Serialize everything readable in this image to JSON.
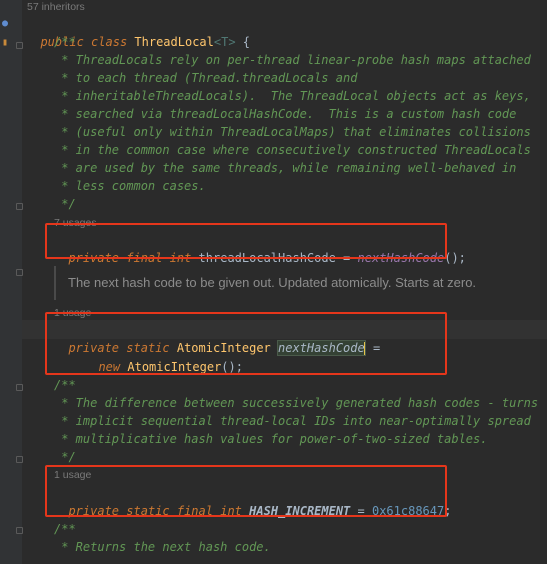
{
  "editor": {
    "inheritors_hint": "57 inheritors",
    "class_decl": {
      "kw_public": "public",
      "kw_class": "class",
      "name": "ThreadLocal",
      "generic": "<T>",
      "brace": " {"
    },
    "doc1": [
      "/**",
      " * ThreadLocals rely on per-thread linear-probe hash maps attached",
      " * to each thread (Thread.threadLocals and",
      " * inheritableThreadLocals).  The ThreadLocal objects act as keys,",
      " * searched via threadLocalHashCode.  This is a custom hash code",
      " * (useful only within ThreadLocalMaps) that eliminates collisions",
      " * in the common case where consecutively constructed ThreadLocals",
      " * are used by the same threads, while remaining well-behaved in",
      " * less common cases.",
      " */"
    ],
    "field1": {
      "usages": "7 usages",
      "kw_private": "private",
      "kw_final": "final",
      "kw_int": "int",
      "name": "threadLocalHashCode",
      "eq": " = ",
      "call": "nextHashCode",
      "tail": "();"
    },
    "rendered_doc": "The next hash code to be given out. Updated atomically. Starts at zero.",
    "field2": {
      "usages": "1 usage",
      "kw_private": "private",
      "kw_static": "static",
      "type": "AtomicInteger",
      "name": "nextHashCode",
      "eq": " =",
      "kw_new": "new",
      "ctor": "AtomicInteger",
      "tail": "();"
    },
    "doc2": [
      "/**",
      " * The difference between successively generated hash codes - turns",
      " * implicit sequential thread-local IDs into near-optimally spread",
      " * multiplicative hash values for power-of-two-sized tables.",
      " */"
    ],
    "field3": {
      "usages": "1 usage",
      "kw_private": "private",
      "kw_static": "static",
      "kw_final": "final",
      "kw_int": "int",
      "name": "HASH_INCREMENT",
      "eq": " = ",
      "value": "0x61c88647",
      "semi": ";"
    },
    "doc3": [
      "/**",
      " * Returns the next hash code."
    ],
    "highlight_color": "#e5361b"
  }
}
